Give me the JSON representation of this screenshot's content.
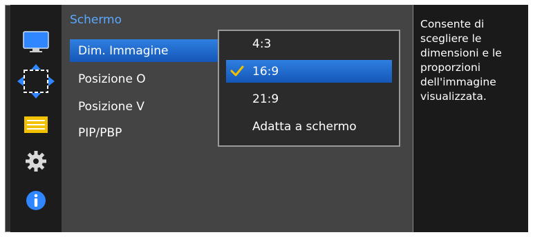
{
  "sidebar": {
    "icons": [
      "monitor-icon",
      "picture-size-icon",
      "menu-list-icon",
      "gear-icon",
      "info-icon"
    ],
    "accent": "#2f86ff"
  },
  "main": {
    "section_title": "Schermo",
    "items": [
      {
        "label": "Dim. Immagine",
        "selected": true
      },
      {
        "label": "Posizione O",
        "selected": false
      },
      {
        "label": "Posizione V",
        "selected": false
      },
      {
        "label": "PIP/PBP",
        "selected": false
      }
    ]
  },
  "popup": {
    "options": [
      {
        "label": "4:3",
        "checked": false
      },
      {
        "label": "16:9",
        "checked": true
      },
      {
        "label": "21:9",
        "checked": false
      },
      {
        "label": "Adatta a schermo",
        "checked": false
      }
    ]
  },
  "help": {
    "text": "Consente di scegliere le dimensioni e le proporzioni dell'immagine visualizzata."
  },
  "colors": {
    "selected_bg": "#1f6fd6",
    "title": "#5aa8ff",
    "check": "#f2c200"
  }
}
